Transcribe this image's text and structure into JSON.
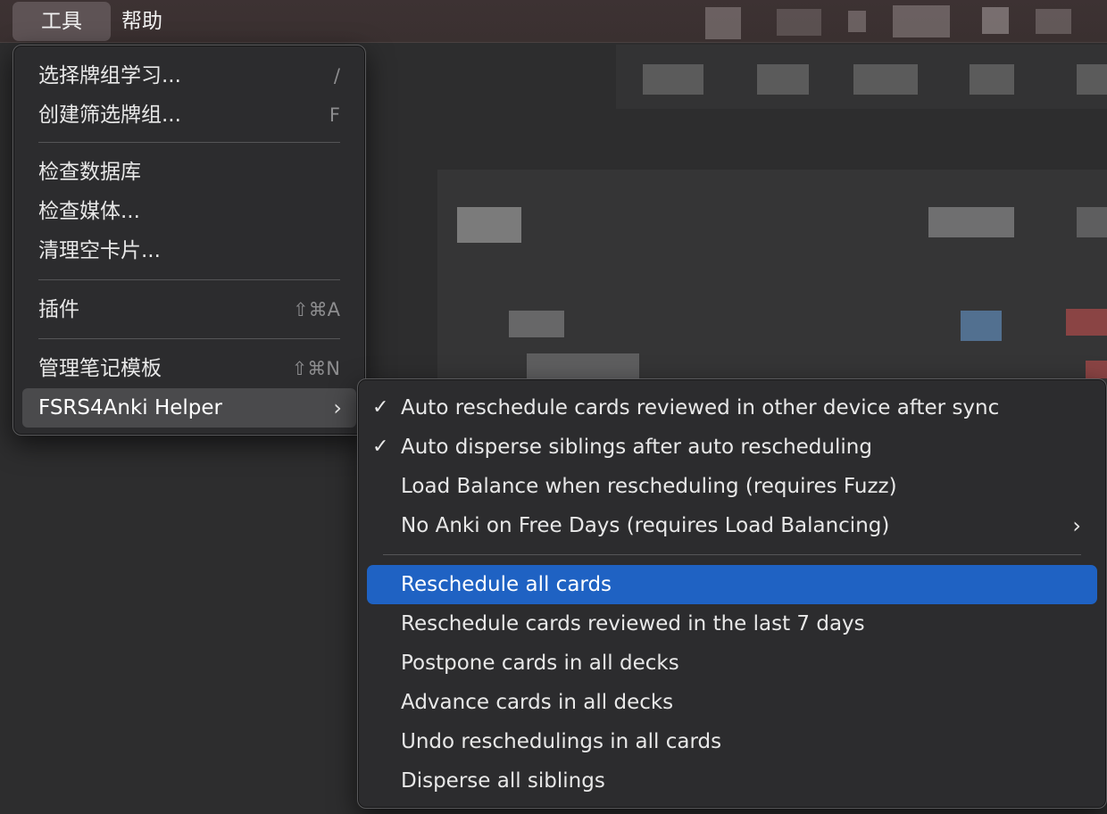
{
  "menubar": {
    "tools": "工具",
    "help": "帮助"
  },
  "tools_menu": {
    "items": [
      {
        "label": "选择牌组学习...",
        "shortcut": "/"
      },
      {
        "label": "创建筛选牌组...",
        "shortcut": "F"
      },
      {
        "label": "检查数据库",
        "shortcut": ""
      },
      {
        "label": "检查媒体...",
        "shortcut": ""
      },
      {
        "label": "清理空卡片...",
        "shortcut": ""
      },
      {
        "label": "插件",
        "shortcut": "⇧⌘A"
      },
      {
        "label": "管理笔记模板",
        "shortcut": "⇧⌘N"
      },
      {
        "label": "FSRS4Anki Helper",
        "shortcut": ""
      }
    ],
    "submenu_chevron": "›"
  },
  "helper_menu": {
    "check_glyph": "✓",
    "items": [
      {
        "label": "Auto reschedule cards reviewed in other device after sync",
        "checked": true
      },
      {
        "label": "Auto disperse siblings after auto rescheduling",
        "checked": true
      },
      {
        "label": "Load Balance when rescheduling (requires Fuzz)",
        "checked": false
      },
      {
        "label": "No Anki on Free Days (requires Load Balancing)",
        "checked": false,
        "has_submenu": true
      },
      {
        "label": "Reschedule all cards",
        "selected": true
      },
      {
        "label": "Reschedule cards reviewed in the last 7 days"
      },
      {
        "label": "Postpone cards in all decks"
      },
      {
        "label": "Advance cards in all decks"
      },
      {
        "label": "Undo reschedulings in all cards"
      },
      {
        "label": "Disperse all siblings"
      }
    ]
  },
  "colors": {
    "selection": "#1f62c3",
    "menu_bg": "#2c2c2e",
    "menubar_bg": "#3d3233"
  }
}
